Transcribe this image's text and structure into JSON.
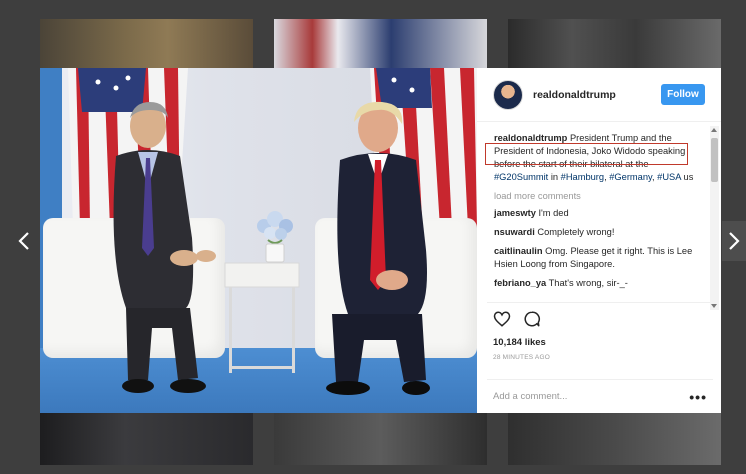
{
  "post": {
    "username": "realdonaldtrump",
    "follow_label": "Follow",
    "caption_user": "realdonaldtrump",
    "caption_pre": " President Trump and the ",
    "caption_highlight": "President of Indonesia, Joko Widodo",
    "caption_mid": " speaking before the start of their bilateral at the ",
    "caption_tag1": "#G20Summit",
    "caption_in": " in ",
    "caption_tag2": "#Hamburg",
    "caption_comma1": ", ",
    "caption_tag3": "#Germany",
    "caption_comma2": ", ",
    "caption_tag4": "#USA",
    "caption_end": " us",
    "load_more": "load more comments",
    "likes": "10,184 likes",
    "time": "28 MINUTES AGO",
    "add_comment_placeholder": "Add a comment...",
    "more_label": "•••"
  },
  "comments": [
    {
      "user": "jameswty",
      "text": "I'm ded"
    },
    {
      "user": "nsuwardi",
      "text": "Completely wrong!"
    },
    {
      "user": "caitlinaulin",
      "text": "Omg. Please get it right. This is Lee Hsien Loong from Singapore."
    },
    {
      "user": "febriano_ya",
      "text": "That's wrong, sir-_-"
    }
  ],
  "icons": {
    "like": "heart-icon",
    "comment": "comment-bubble-icon",
    "prev": "chevron-left-icon",
    "next": "chevron-right-icon"
  },
  "colors": {
    "accent": "#3897f0",
    "highlight_box": "#c0392b",
    "hashtag": "#003569"
  }
}
